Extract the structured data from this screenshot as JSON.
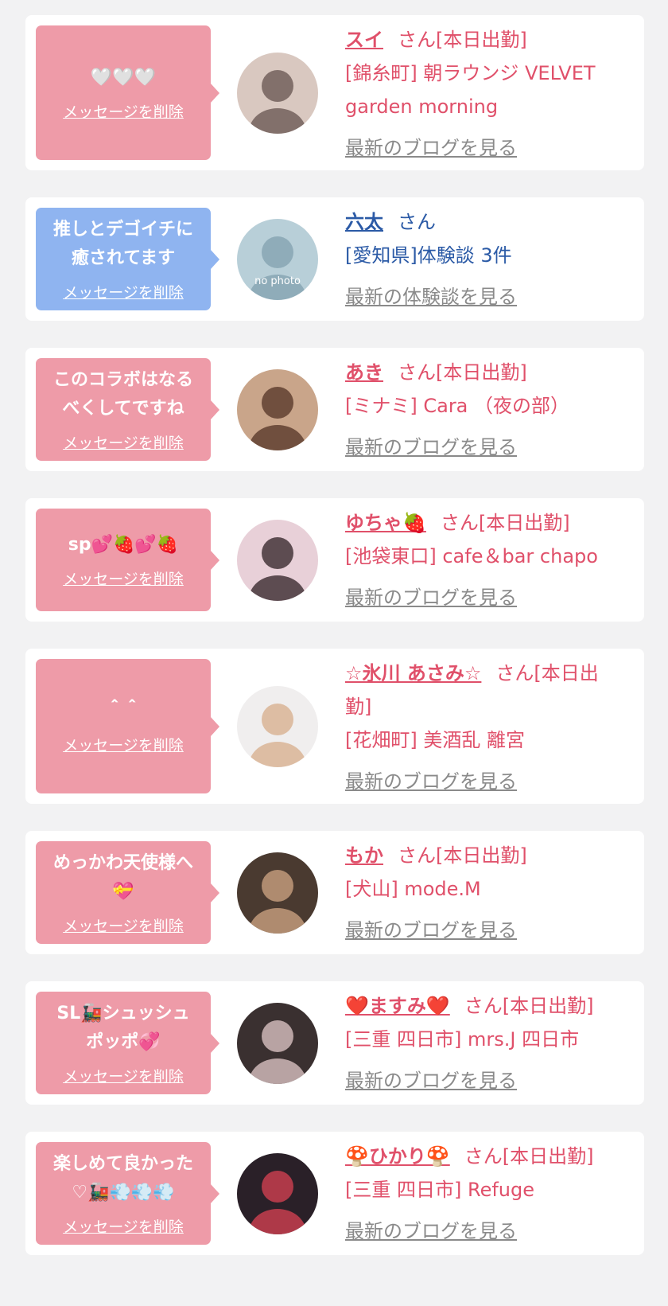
{
  "colors": {
    "background": "#f2f2f3",
    "card": "#ffffff",
    "bubble_pink": "#ee9ba8",
    "bubble_blue": "#8fb4f0",
    "text_pink": "#e0506a",
    "text_blue": "#2b5aa6",
    "link_gray": "#8a8a8a"
  },
  "cards": [
    {
      "message": "🤍🤍🤍",
      "delete_label": "メッセージを削除",
      "name": "スイ",
      "suffix": "さん[本日出勤]",
      "shop": "[錦糸町] 朝ラウンジ VELVET garden morning",
      "link_label": "最新のブログを見る",
      "avatar": "photo",
      "theme": "pink"
    },
    {
      "message": "推しとデゴイチに\n癒されてます",
      "delete_label": "メッセージを削除",
      "name": "六太",
      "suffix": "さん",
      "shop": "[愛知県]体験談 3件",
      "link_label": "最新の体験談を見る",
      "avatar": "no-photo",
      "avatar_text": "no photo",
      "theme": "blue"
    },
    {
      "message": "このコラボはなる\nべくしてですね",
      "delete_label": "メッセージを削除",
      "name": "あき",
      "suffix": "さん[本日出勤]",
      "shop": "[ミナミ] Cara （夜の部）",
      "link_label": "最新のブログを見る",
      "avatar": "photo",
      "theme": "pink"
    },
    {
      "message": "sp💕🍓💕🍓",
      "delete_label": "メッセージを削除",
      "name": "ゆちゃ🍓",
      "suffix": "さん[本日出勤]",
      "shop": "[池袋東口] cafe＆bar chapo",
      "link_label": "最新のブログを見る",
      "avatar": "photo",
      "theme": "pink"
    },
    {
      "message": "＾＾",
      "delete_label": "メッセージを削除",
      "name": "☆氷川 あさみ☆",
      "suffix": "さん[本日出勤]",
      "shop": "[花畑町] 美酒乱 離宮",
      "link_label": "最新のブログを見る",
      "avatar": "photo",
      "theme": "pink"
    },
    {
      "message": "めっかわ天使様へ\n💝",
      "delete_label": "メッセージを削除",
      "name": "もか",
      "suffix": "さん[本日出勤]",
      "shop": "[犬山] mode.M",
      "link_label": "最新のブログを見る",
      "avatar": "photo",
      "theme": "pink"
    },
    {
      "message": "SL🚂シュッシュ\nポッポ💞",
      "delete_label": "メッセージを削除",
      "name": "❤️ますみ❤️",
      "suffix": "さん[本日出勤]",
      "shop": "[三重 四日市] mrs.J 四日市",
      "link_label": "最新のブログを見る",
      "avatar": "photo",
      "theme": "pink"
    },
    {
      "message": "楽しめて良かった\n♡🚂💨💨💨",
      "delete_label": "メッセージを削除",
      "name": "🍄ひかり🍄",
      "suffix": "さん[本日出勤]",
      "shop": "[三重 四日市] Refuge",
      "link_label": "最新のブログを見る",
      "avatar": "photo",
      "theme": "pink"
    }
  ]
}
